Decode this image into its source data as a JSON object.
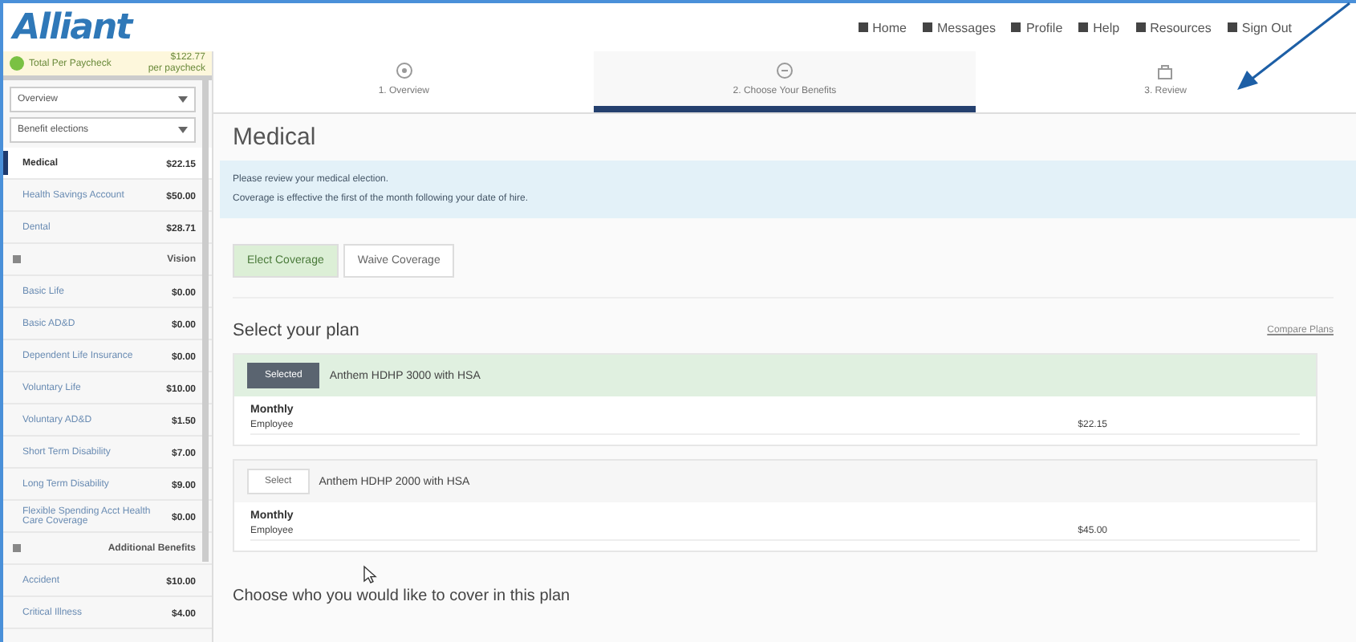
{
  "header": {
    "logo": "Alliant",
    "nav": [
      {
        "label": "Home"
      },
      {
        "label": "Messages"
      },
      {
        "label": "Profile"
      },
      {
        "label": "Help"
      },
      {
        "label": "Resources"
      },
      {
        "label": "Sign Out"
      }
    ]
  },
  "summary": {
    "label": "Total Per Paycheck",
    "amount": "$122.77",
    "note": "per paycheck"
  },
  "steps": [
    {
      "label": "1. Overview",
      "selected": false
    },
    {
      "label": "2. Choose Your Benefits",
      "selected": true
    },
    {
      "label": "3. Review",
      "selected": false
    }
  ],
  "sidebar": {
    "dropdown": "Overview",
    "select": "Benefit elections",
    "items": [
      {
        "kind": "item",
        "label": "Medical",
        "amount": "$22.15",
        "selected": true
      },
      {
        "kind": "item",
        "label": "Health Savings Account",
        "amount": "$50.00",
        "selected": false
      },
      {
        "kind": "item",
        "label": "Dental",
        "amount": "$28.71",
        "selected": false
      },
      {
        "kind": "group",
        "label": "Vision",
        "selected": false
      },
      {
        "kind": "item",
        "label": "Basic Life",
        "amount": "$0.00",
        "selected": false
      },
      {
        "kind": "item",
        "label": "Basic AD&D",
        "amount": "$0.00",
        "selected": false
      },
      {
        "kind": "item",
        "label": "Dependent Life Insurance",
        "amount": "$0.00",
        "selected": false
      },
      {
        "kind": "item",
        "label": "Voluntary Life",
        "amount": "$10.00",
        "selected": false
      },
      {
        "kind": "item",
        "label": "Voluntary AD&D",
        "amount": "$1.50",
        "selected": false
      },
      {
        "kind": "item",
        "label": "Short Term Disability",
        "amount": "$7.00",
        "selected": false
      },
      {
        "kind": "item",
        "label": "Long Term Disability",
        "amount": "$9.00",
        "selected": false
      },
      {
        "kind": "item",
        "label": "Flexible Spending Acct Health Care Coverage",
        "amount": "$0.00",
        "selected": false
      },
      {
        "kind": "group",
        "label": "Additional Benefits",
        "selected": false
      },
      {
        "kind": "item",
        "label": "Accident",
        "amount": "$10.00",
        "selected": false
      },
      {
        "kind": "item",
        "label": "Critical Illness",
        "amount": "$4.00",
        "selected": false
      }
    ]
  },
  "main": {
    "title": "Medical",
    "info": [
      "Please review your medical election.",
      "Coverage is effective the first of the month following your date of hire."
    ],
    "choices": [
      {
        "label": "Elect Coverage",
        "selected": true
      },
      {
        "label": "Waive Coverage",
        "selected": false
      }
    ],
    "plans_title": "Select your plan",
    "compare": "Compare Plans",
    "plans": [
      {
        "button": "Selected",
        "name": "Anthem HDHP 3000 with HSA",
        "selected": true,
        "period": "Monthly",
        "tier": "Employee",
        "cost": "$22.15"
      },
      {
        "button": "Select",
        "name": "Anthem HDHP 2000 with HSA",
        "selected": false,
        "period": "Monthly",
        "tier": "Employee",
        "cost": "$45.00"
      }
    ],
    "cover_title": "Choose who you would like to cover in this plan"
  }
}
